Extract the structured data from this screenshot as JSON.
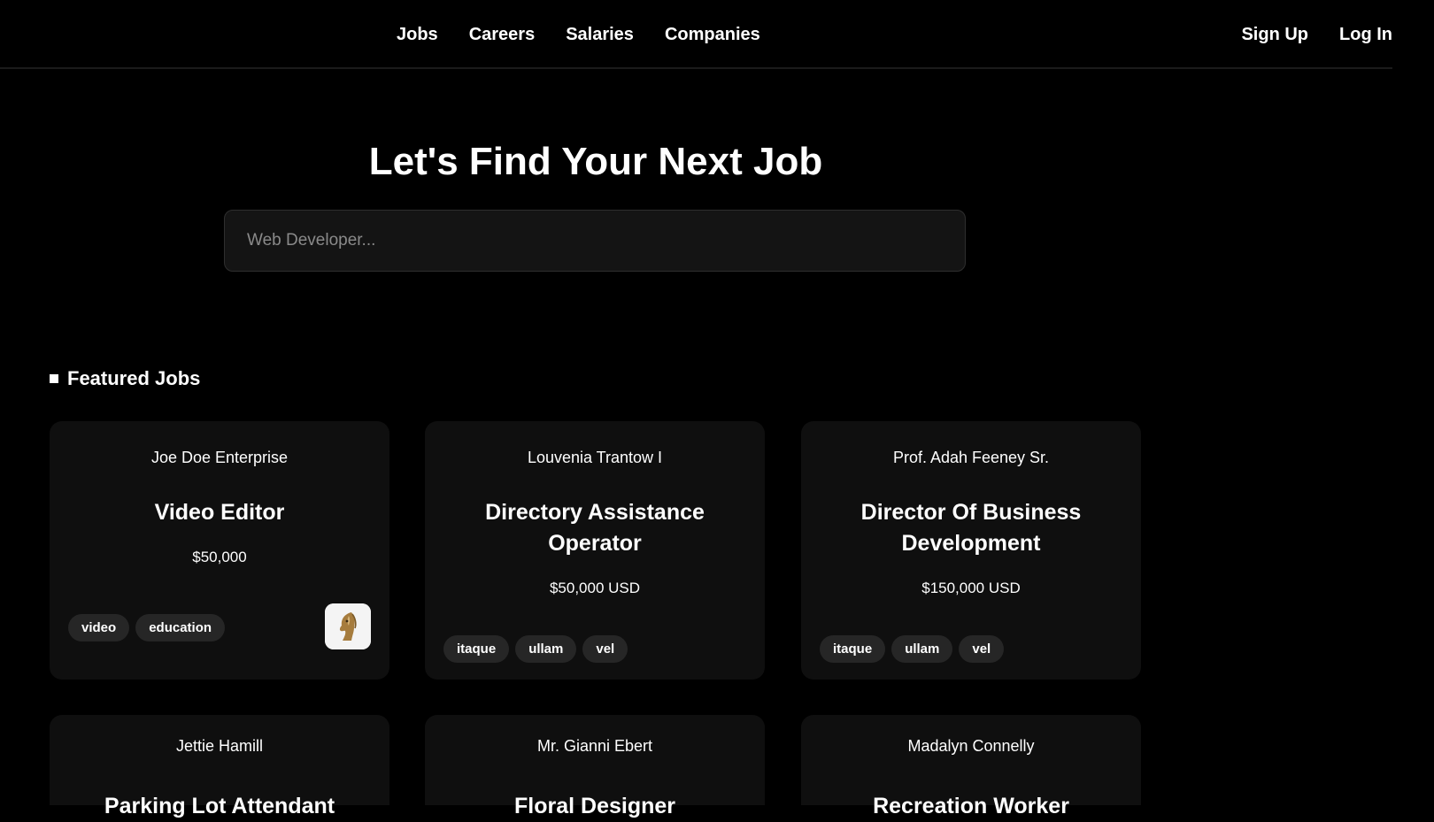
{
  "nav": {
    "links": [
      "Jobs",
      "Careers",
      "Salaries",
      "Companies"
    ],
    "signup": "Sign Up",
    "login": "Log In"
  },
  "hero": {
    "title": "Let's Find Your Next Job",
    "search_placeholder": "Web Developer..."
  },
  "featured": {
    "heading": "Featured Jobs",
    "jobs": [
      {
        "company": "Joe Doe Enterprise",
        "title": "Video Editor",
        "salary": "$50,000",
        "tags": [
          "video",
          "education"
        ],
        "has_logo": true
      },
      {
        "company": "Louvenia Trantow I",
        "title": "Directory Assistance Operator",
        "salary": "$50,000 USD",
        "tags": [
          "itaque",
          "ullam",
          "vel"
        ]
      },
      {
        "company": "Prof. Adah Feeney Sr.",
        "title": "Director Of Business Development",
        "salary": "$150,000 USD",
        "tags": [
          "itaque",
          "ullam",
          "vel"
        ]
      },
      {
        "company": "Jettie Hamill",
        "title": "Parking Lot Attendant"
      },
      {
        "company": "Mr. Gianni Ebert",
        "title": "Floral Designer"
      },
      {
        "company": "Madalyn Connelly",
        "title": "Recreation Worker"
      }
    ]
  },
  "colors": {
    "background": "#000000",
    "card": "#0f0f0f",
    "tag": "#262626",
    "text": "#ffffff"
  }
}
